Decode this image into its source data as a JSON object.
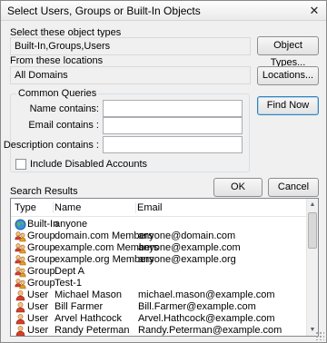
{
  "window": {
    "title": "Select Users, Groups or Built-In Objects"
  },
  "object_types": {
    "label": "Select these object types",
    "value": "Built-In,Groups,Users",
    "button": "Object Types..."
  },
  "locations": {
    "label": "From these locations",
    "value": "All Domains",
    "button": "Locations..."
  },
  "common_queries": {
    "legend": "Common Queries",
    "name_label": "Name contains:",
    "email_label": "Email contains :",
    "description_label": "Description contains :",
    "name_value": "",
    "email_value": "",
    "description_value": "",
    "include_disabled_label": "Include Disabled Accounts",
    "include_disabled_checked": false
  },
  "buttons": {
    "find_now": "Find Now",
    "ok": "OK",
    "cancel": "Cancel"
  },
  "results": {
    "label": "Search Results",
    "columns": [
      "Type",
      "Name",
      "Email"
    ],
    "rows": [
      {
        "icon": "globe-icon",
        "type": "Built-In",
        "name": "anyone",
        "email": ""
      },
      {
        "icon": "group-icon",
        "type": "Group",
        "name": "domain.com Members",
        "email": "anyone@domain.com"
      },
      {
        "icon": "group-icon",
        "type": "Group",
        "name": "example.com Members",
        "email": "anyone@example.com"
      },
      {
        "icon": "group-icon",
        "type": "Group",
        "name": "example.org Members",
        "email": "anyone@example.org"
      },
      {
        "icon": "group-icon",
        "type": "Group",
        "name": "Dept A",
        "email": ""
      },
      {
        "icon": "group-icon",
        "type": "Group",
        "name": "Test-1",
        "email": ""
      },
      {
        "icon": "user-icon",
        "type": "User",
        "name": "Michael Mason",
        "email": "michael.mason@example.com"
      },
      {
        "icon": "user-icon",
        "type": "User",
        "name": "Bill Farmer",
        "email": "Bill.Farmer@example.com"
      },
      {
        "icon": "user-icon",
        "type": "User",
        "name": "Arvel Hathcock",
        "email": "Arvel.Hathcock@example.com"
      },
      {
        "icon": "user-icon",
        "type": "User",
        "name": "Randy Peterman",
        "email": "Randy.Peterman@example.com"
      }
    ]
  }
}
